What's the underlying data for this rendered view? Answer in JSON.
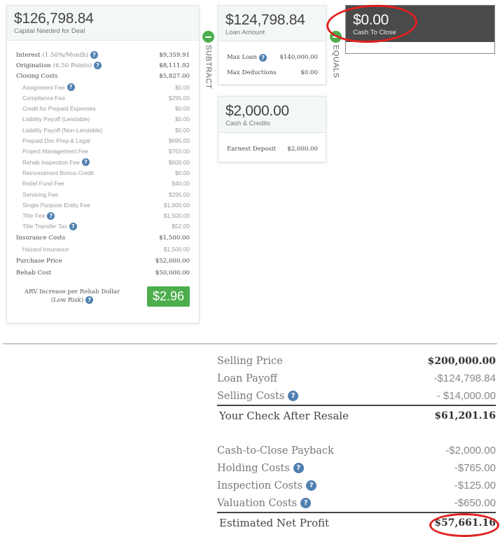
{
  "capital_card": {
    "amount": "$126,798.84",
    "label": "Capital Needed for Deal",
    "rows": [
      {
        "type": "main",
        "label": "Interest",
        "paren": "(1.50%/Month)",
        "help": true,
        "value": "$9,359.91"
      },
      {
        "type": "main",
        "label": "Origination",
        "paren": "(6.50 Points)",
        "help": true,
        "value": "$8,111.92"
      },
      {
        "type": "main",
        "label": "Closing Costs",
        "paren": "",
        "help": false,
        "value": "$5,827.00"
      },
      {
        "type": "child",
        "label": "Assignment Fee",
        "help": true,
        "value": "$0.00"
      },
      {
        "type": "child",
        "label": "Compliance Fee",
        "help": false,
        "value": "$295.00"
      },
      {
        "type": "child",
        "label": "Credit for Prepaid Expenses",
        "help": false,
        "value": "$0.00"
      },
      {
        "type": "child",
        "label": "Liability Payoff (Lendable)",
        "help": false,
        "value": "$0.00"
      },
      {
        "type": "child",
        "label": "Liability Payoff (Non-Lendable)",
        "help": false,
        "value": "$0.00"
      },
      {
        "type": "child",
        "label": "Prepaid Doc Prep & Legal",
        "help": false,
        "value": "$695.00"
      },
      {
        "type": "child",
        "label": "Project Management Fee",
        "help": false,
        "value": "$750.00"
      },
      {
        "type": "child",
        "label": "Rehab Inspection Fee",
        "help": true,
        "value": "$600.00"
      },
      {
        "type": "child",
        "label": "Reinvestment Bonus Credit",
        "help": false,
        "value": "$0.00"
      },
      {
        "type": "child",
        "label": "Relief Fund Fee",
        "help": false,
        "value": "$40.00"
      },
      {
        "type": "child",
        "label": "Servicing Fee",
        "help": false,
        "value": "$295.00"
      },
      {
        "type": "child",
        "label": "Single Purpose Entity Fee",
        "help": false,
        "value": "$1,600.00"
      },
      {
        "type": "child",
        "label": "Title Fee",
        "help": true,
        "value": "$1,500.00"
      },
      {
        "type": "child",
        "label": "Title Transfer Tax",
        "help": true,
        "value": "$52.00"
      },
      {
        "type": "main",
        "label": "Insurance Costs",
        "paren": "",
        "help": false,
        "value": "$1,500.00"
      },
      {
        "type": "child",
        "label": "Hazard Insurance",
        "help": false,
        "value": "$1,500.00"
      },
      {
        "type": "main",
        "label": "Purchase Price",
        "paren": "",
        "help": false,
        "value": "$52,000.00"
      },
      {
        "type": "main",
        "label": "Rehab Cost",
        "paren": "",
        "help": false,
        "value": "$50,000.00"
      }
    ],
    "arv_label_line1": "ARV Increase per Rehab Dollar",
    "arv_label_line2": "(Low Risk)",
    "arv_value": "$2.96"
  },
  "operators": {
    "subtract": "SUBTRACT",
    "equals": "EQUALS"
  },
  "loan_card": {
    "amount": "$124,798.84",
    "label": "Loan Amount",
    "rows": [
      {
        "label": "Max Loan",
        "help": true,
        "value": "$140,000.00"
      },
      {
        "label": "Max Deductions",
        "help": false,
        "value": "$0.00"
      }
    ]
  },
  "cash_card": {
    "amount": "$2,000.00",
    "label": "Cash & Credits",
    "rows": [
      {
        "label": "Earnest Deposit",
        "help": false,
        "value": "$2,000.00"
      }
    ]
  },
  "close_card": {
    "amount": "$0.00",
    "label": "Cash To Close"
  },
  "summary": {
    "group1": [
      {
        "label": "Selling Price",
        "help": false,
        "value": "$200,000.00",
        "bold": true
      },
      {
        "label": "Loan Payoff",
        "help": false,
        "value": "-$124,798.84",
        "bold": false
      },
      {
        "label": "Selling Costs",
        "help": true,
        "value": "- $14,000.00",
        "bold": false
      }
    ],
    "total1": {
      "label": "Your Check After Resale",
      "value": "$61,201.16"
    },
    "group2": [
      {
        "label": "Cash-to-Close Payback",
        "help": false,
        "value": "-$2,000.00",
        "bold": false
      },
      {
        "label": "Holding Costs",
        "help": true,
        "value": "-$765.00",
        "bold": false
      },
      {
        "label": "Inspection Costs",
        "help": true,
        "value": "-$125.00",
        "bold": false
      },
      {
        "label": "Valuation Costs",
        "help": true,
        "value": "-$650.00",
        "bold": false
      }
    ],
    "total2": {
      "label": "Estimated Net Profit",
      "value": "$57,661.16"
    }
  },
  "colors": {
    "accent_green": "#4cae4c",
    "help_blue": "#4f80b0",
    "annotation_red": "#e02020",
    "dark_card": "#4a4a4a"
  }
}
